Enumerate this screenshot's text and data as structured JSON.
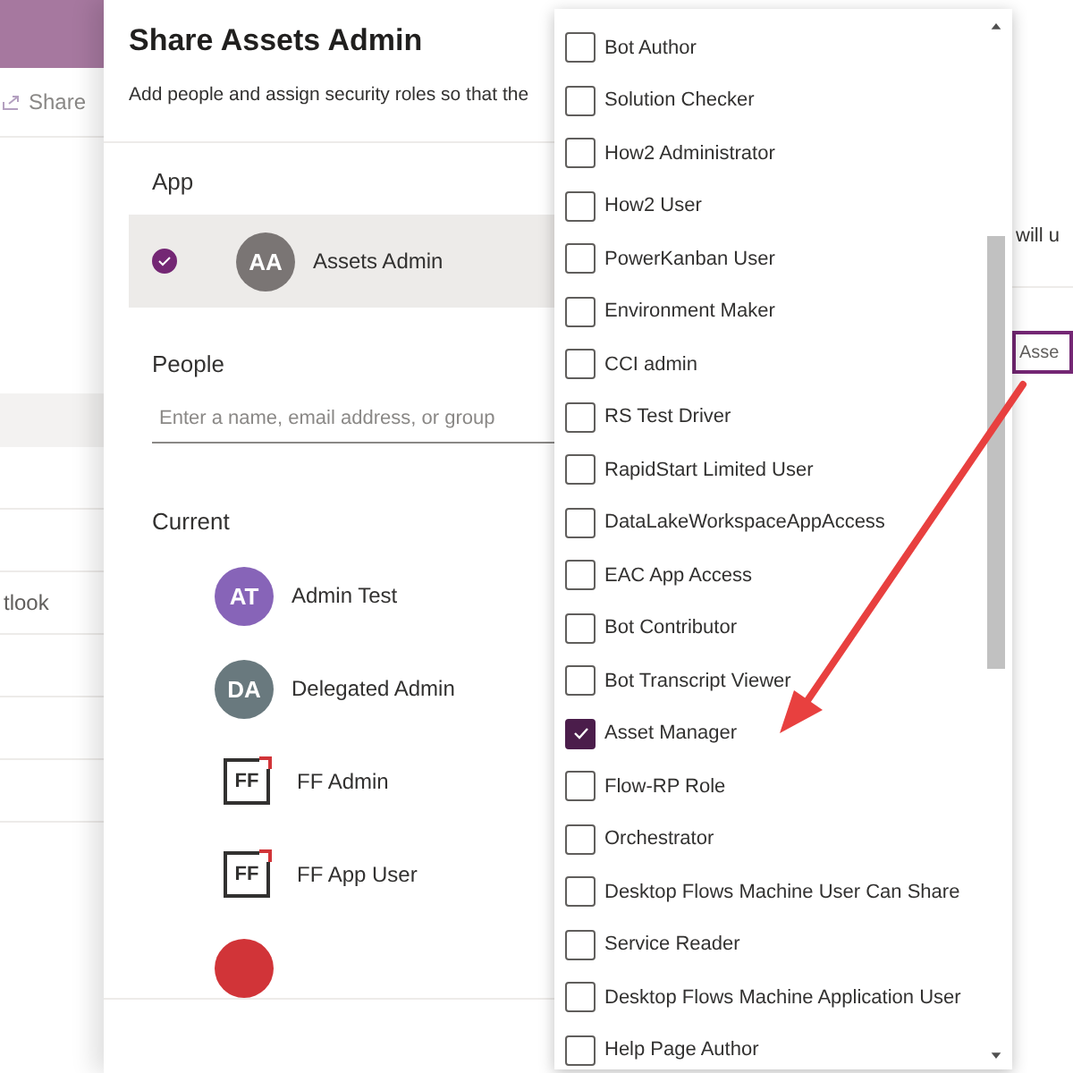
{
  "background": {
    "toolbar_button": "Share",
    "row_text": "tlook"
  },
  "dialog": {
    "title": "Share Assets Admin",
    "subtitle": "Add people and assign security roles so that the",
    "app_section": {
      "heading": "App",
      "app": {
        "initials": "AA",
        "name": "Assets Admin",
        "selected": true
      }
    },
    "people": {
      "heading": "People",
      "placeholder": "Enter a name, email address, or group"
    },
    "current": {
      "heading": "Current",
      "users": [
        {
          "kind": "avatar",
          "initials": "AT",
          "name": "Admin Test",
          "color": "#8764b8"
        },
        {
          "kind": "avatar",
          "initials": "DA",
          "name": "Delegated Admin",
          "color": "#69797e"
        },
        {
          "kind": "logo",
          "initials": "FF",
          "name": "FF Admin"
        },
        {
          "kind": "logo",
          "initials": "FF",
          "name": "FF App User"
        },
        {
          "kind": "avatar",
          "color": "#d13438"
        }
      ]
    },
    "side_note": "will u",
    "role_field": {
      "value": "Asse"
    }
  },
  "roles": [
    {
      "label": "Bot Author",
      "checked": false
    },
    {
      "label": "Solution Checker",
      "checked": false
    },
    {
      "label": "How2 Administrator",
      "checked": false
    },
    {
      "label": "How2 User",
      "checked": false
    },
    {
      "label": "PowerKanban User",
      "checked": false
    },
    {
      "label": "Environment Maker",
      "checked": false
    },
    {
      "label": "CCI admin",
      "checked": false
    },
    {
      "label": "RS Test Driver",
      "checked": false
    },
    {
      "label": "RapidStart Limited User",
      "checked": false
    },
    {
      "label": "DataLakeWorkspaceAppAccess",
      "checked": false
    },
    {
      "label": "EAC App Access",
      "checked": false
    },
    {
      "label": "Bot Contributor",
      "checked": false
    },
    {
      "label": "Bot Transcript Viewer",
      "checked": false
    },
    {
      "label": "Asset Manager",
      "checked": true
    },
    {
      "label": "Flow-RP Role",
      "checked": false
    },
    {
      "label": "Orchestrator",
      "checked": false
    },
    {
      "label": "Desktop Flows Machine User Can Share",
      "checked": false
    },
    {
      "label": "Service Reader",
      "checked": false
    },
    {
      "label": "Desktop Flows Machine Application User",
      "checked": false
    },
    {
      "label": "Help Page Author",
      "checked": false
    }
  ]
}
